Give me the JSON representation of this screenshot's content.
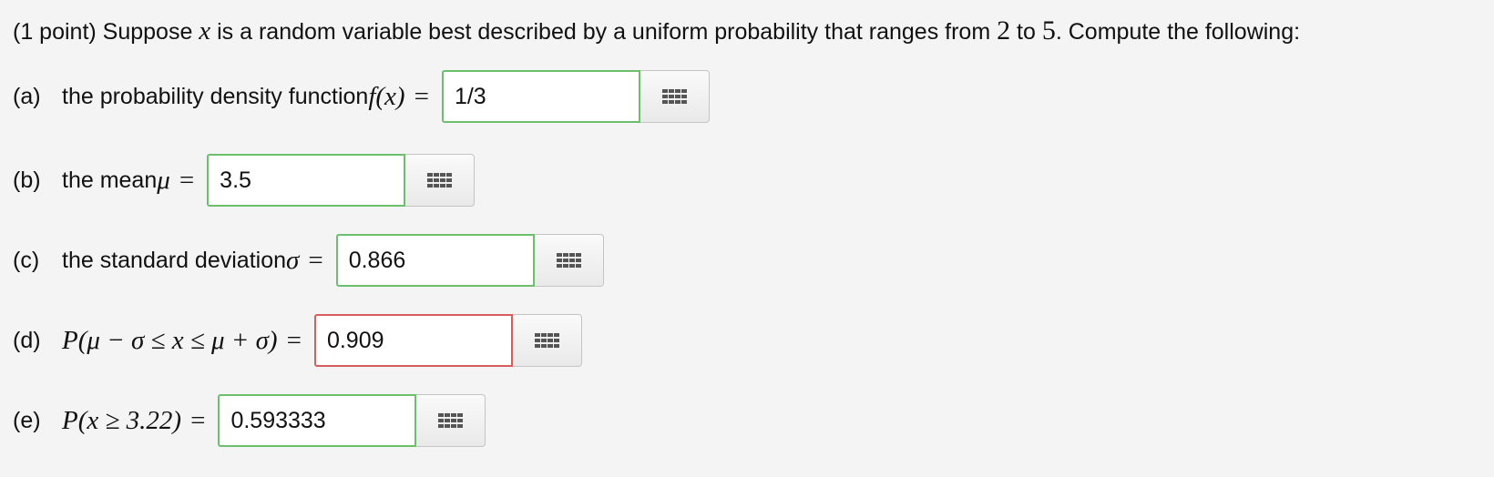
{
  "intro": {
    "lead": "(1 point) Suppose ",
    "variable": "x",
    "mid": " is a random variable best described by a uniform probability that ranges from ",
    "low": "2",
    "to": " to ",
    "high": "5",
    "tail": ". Compute the following:"
  },
  "parts": [
    {
      "label": "(a)",
      "text": "the probability density function ",
      "math": "f(x)",
      "equals": "=",
      "value": "1/3",
      "status": "correct"
    },
    {
      "label": "(b)",
      "text": "the mean ",
      "math": "μ",
      "equals": "=",
      "value": "3.5",
      "status": "correct"
    },
    {
      "label": "(c)",
      "text": "the standard deviation ",
      "math": "σ",
      "equals": "=",
      "value": "0.866",
      "status": "correct"
    },
    {
      "label": "(d)",
      "text": "",
      "math": "P(μ − σ ≤ x ≤ μ + σ)",
      "equals": "=",
      "value": "0.909",
      "status": "incorrect"
    },
    {
      "label": "(e)",
      "text": "",
      "math": "P(x ≥ 3.22)",
      "equals": "=",
      "value": "0.593333",
      "status": "correct"
    }
  ],
  "icons": {
    "palette": "grid-icon"
  },
  "colors": {
    "correct_border": "#6cbf6c",
    "incorrect_border": "#d95c5c",
    "background": "#f4f4f4"
  }
}
